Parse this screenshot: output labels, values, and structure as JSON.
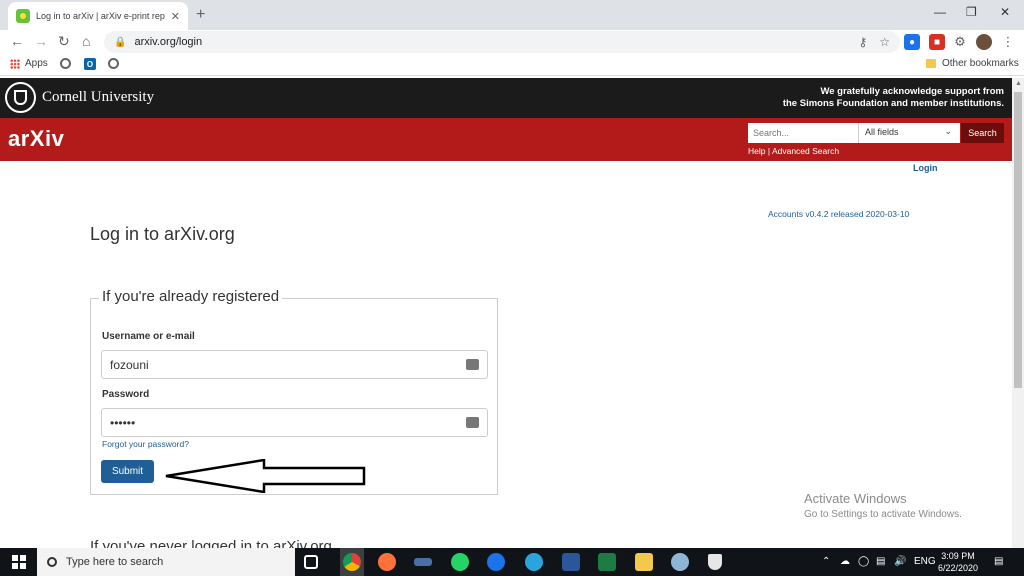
{
  "browser": {
    "tab_title": "Log in to arXiv | arXiv e-print rep",
    "tab_close": "✕",
    "new_tab": "+",
    "url": "arxiv.org/login",
    "bookmarks": {
      "apps": "Apps",
      "other": "Other bookmarks"
    },
    "window_controls": {
      "minimize": "—",
      "restore": "❐",
      "close": "✕"
    }
  },
  "header": {
    "university": "Cornell University",
    "ack_line1": "We gratefully acknowledge support from",
    "ack_line2": "the Simons Foundation and member institutions."
  },
  "searchbar": {
    "logo": "arXiv",
    "placeholder": "Search...",
    "field": "All fields",
    "button": "Search",
    "help": "Help",
    "separator": " | ",
    "advanced": "Advanced Search"
  },
  "page": {
    "login_link": "Login",
    "accounts_version": "Accounts v0.4.2 released 2020-03-10",
    "title": "Log in to arXiv.org"
  },
  "form": {
    "legend": "If you're already registered",
    "username_label": "Username or e-mail",
    "username_value": "fozouni",
    "password_label": "Password",
    "password_value": "••••••",
    "forgot": "Forgot your password?",
    "submit": "Submit"
  },
  "next_section": "If you've never logged in to arXiv.org",
  "watermark": {
    "line1": "Activate Windows",
    "line2": "Go to Settings to activate Windows."
  },
  "taskbar": {
    "search_placeholder": "Type here to search",
    "lang": "ENG",
    "time": "3:09 PM",
    "date": "6/22/2020"
  },
  "colors": {
    "arxiv_red": "#b31b1b",
    "cornell_black": "#1b1b1b",
    "link_blue": "#1f5e96"
  }
}
